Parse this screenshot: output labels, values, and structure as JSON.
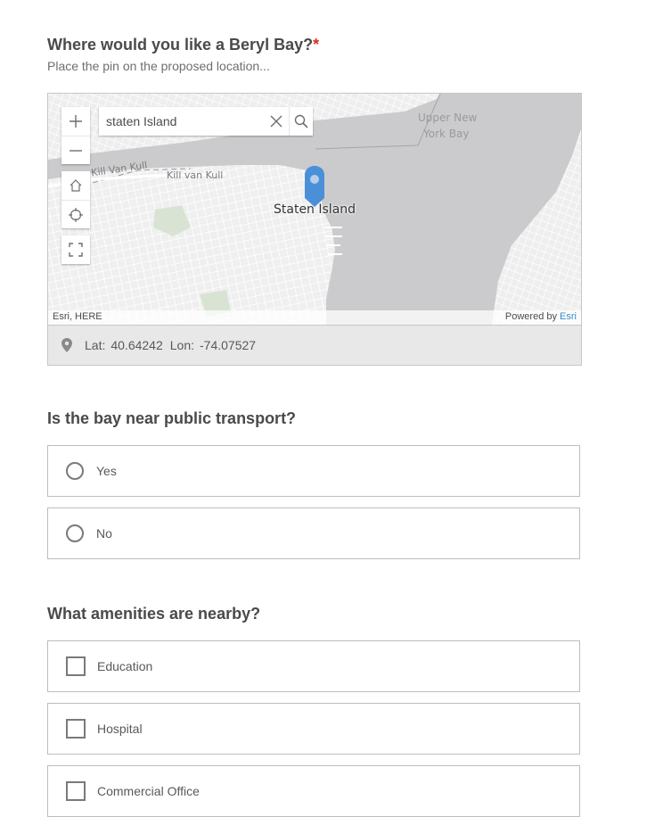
{
  "question1": {
    "title": "Where would you like a Beryl Bay?",
    "required_mark": "*",
    "description": "Place the pin on the proposed location..."
  },
  "map": {
    "search_value": "staten Island",
    "controls": [
      "zoom-in-icon",
      "zoom-out-icon",
      "home-icon",
      "locate-icon",
      "fullscreen-icon"
    ],
    "labels": {
      "kill_van_kull_1": "Kill Van Kull",
      "kill_van_kull_2": "Kill van Kull",
      "upper_new_york_bay_1": "Upper New",
      "upper_new_york_bay_2": "York Bay",
      "staten_island": "Staten Island"
    },
    "attribution_left": "Esri, HERE",
    "attribution_powered": "Powered by ",
    "attribution_esri": "Esri",
    "pin_color": "#4a90d9",
    "coords": {
      "lat_label": "Lat:",
      "lat": "40.64242",
      "lon_label": "Lon:",
      "lon": "-74.07527"
    }
  },
  "question2": {
    "title": "Is the bay near public transport?",
    "options": [
      "Yes",
      "No"
    ]
  },
  "question3": {
    "title": "What amenities are nearby?",
    "options": [
      "Education",
      "Hospital",
      "Commercial Office"
    ]
  }
}
